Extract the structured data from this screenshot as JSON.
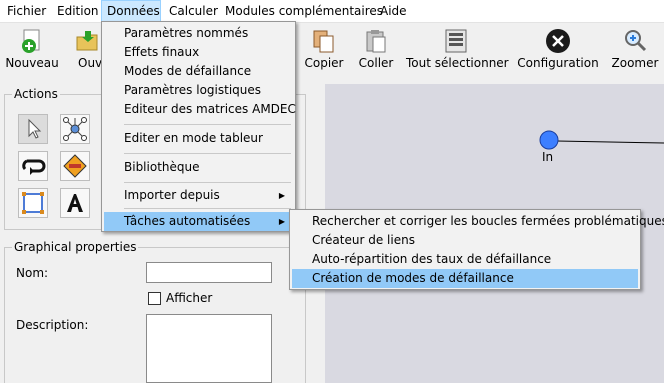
{
  "menubar": {
    "items": [
      "Fichier",
      "Edition",
      "Données",
      "Calculer",
      "Modules complémentaires",
      "Aide"
    ]
  },
  "toolbar": {
    "nouveau": "Nouveau",
    "ouvrir": "Ouvr",
    "copier": "Copier",
    "coller": "Coller",
    "tout_selectionner": "Tout sélectionner",
    "configuration": "Configuration",
    "zoomer": "Zoomer"
  },
  "actions": {
    "title": "Actions",
    "tools": [
      "select-arrow-icon",
      "network-node-icon",
      "loop-icon",
      "warning-sign-icon",
      "rectangle-icon",
      "text-a-icon"
    ]
  },
  "graphical_properties": {
    "title": "Graphical properties",
    "nom_label": "Nom:",
    "nom_value": "",
    "afficher_label": "Afficher",
    "afficher_checked": false,
    "description_label": "Description:",
    "description_value": ""
  },
  "canvas": {
    "node_label": "In"
  },
  "donnees_menu": {
    "items": [
      "Paramètres nommés",
      "Effets finaux",
      "Modes de défaillance",
      "Paramètres logistiques",
      "Editeur des matrices AMDEC",
      "Editer en mode tableur",
      "Bibliothèque",
      "Importer depuis",
      "Tâches automatisées"
    ]
  },
  "taches_submenu": {
    "items": [
      "Rechercher et corriger les boucles fermées problématiques",
      "Créateur de liens",
      "Auto-répartition des taux de défaillance",
      "Création de modes de défaillance"
    ]
  },
  "colors": {
    "highlight": "#91c9f7",
    "node": "#3d7fff",
    "canvas": "#d9d9e1"
  }
}
